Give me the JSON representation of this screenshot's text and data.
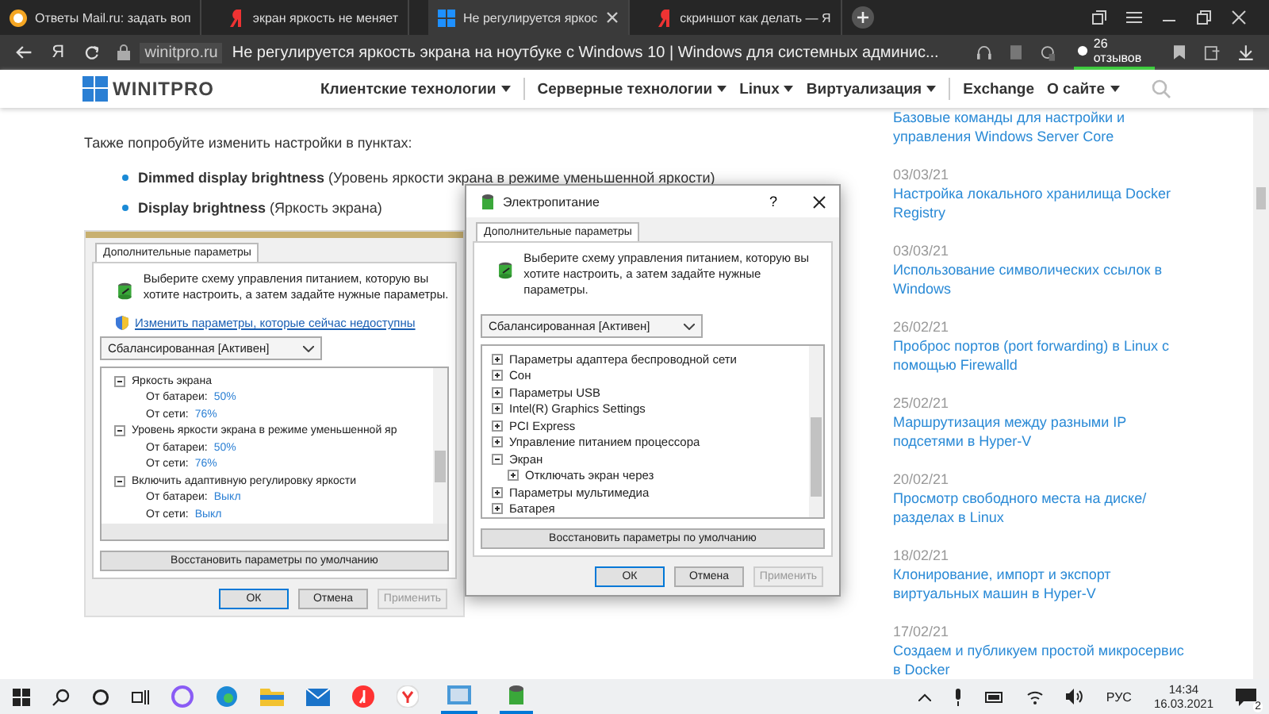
{
  "browser": {
    "tabs": [
      {
        "title": "Ответы Mail.ru: задать воп",
        "selected": false
      },
      {
        "title": "экран яркость не меняет",
        "selected": false
      },
      {
        "title": "Не регулируется яркос",
        "selected": true
      },
      {
        "title": "скриншот как делать — Я",
        "selected": false
      }
    ],
    "logo": "Я",
    "domain": "winitpro.ru",
    "page_title": "Не регулируется яркость экрана на ноутбуке с Windows 10 | Windows для системных админис...",
    "reviews": "26 отзывов"
  },
  "site": {
    "logo": "WINITPRO",
    "nav": [
      {
        "label": "Клиентские технологии",
        "dropdown": true
      },
      {
        "label": "Серверные технологии",
        "dropdown": true
      },
      {
        "label": "Linux",
        "dropdown": true
      },
      {
        "label": "Виртуализация",
        "dropdown": true
      },
      {
        "label": "Exchange",
        "dropdown": false
      },
      {
        "label": "О сайте",
        "dropdown": true
      }
    ]
  },
  "article": {
    "intro": "Также попробуйте изменить настройки в пунктах:",
    "bullets": [
      "**Dimmed display brightness** (Уровень яркости экрана в режиме уменьшенной яркости)",
      "**Display brightness** (Яркость экрана)"
    ]
  },
  "screenshot": {
    "tab": "Дополнительные параметры",
    "description": "Выберите схему управления питанием, которую вы хотите настроить, а затем задайте нужные параметры.",
    "link": "Изменить параметры, которые сейчас недоступны",
    "scheme": "Сбалансированная [Активен]",
    "tree": [
      {
        "label": "Яркость экрана",
        "expanded": true,
        "children": [
          {
            "label": "От батареи:",
            "value": "50%"
          },
          {
            "label": "От сети:",
            "value": "76%"
          }
        ]
      },
      {
        "label": "Уровень яркости экрана в режиме уменьшенной яр",
        "expanded": true,
        "children": [
          {
            "label": "От батареи:",
            "value": "50%"
          },
          {
            "label": "От сети:",
            "value": "76%"
          }
        ]
      },
      {
        "label": "Включить адаптивную регулировку яркости",
        "expanded": true,
        "children": [
          {
            "label": "От батареи:",
            "value": "Выкл"
          },
          {
            "label": "От сети:",
            "value": "Выкл"
          }
        ]
      }
    ],
    "restore": "Восстановить параметры по умолчанию",
    "buttons": [
      {
        "label": "ОК",
        "disabled": false
      },
      {
        "label": "Отмена",
        "disabled": false
      },
      {
        "label": "Применить",
        "disabled": true
      }
    ]
  },
  "dialog": {
    "title": "Электропитание",
    "help": "?",
    "tab": "Дополнительные параметры",
    "description": "Выберите схему управления питанием, которую вы хотите настроить, а затем задайте нужные параметры.",
    "scheme": "Сбалансированная [Активен]",
    "tree": [
      {
        "label": "Параметры адаптера беспроводной сети",
        "expanded": false
      },
      {
        "label": "Сон",
        "expanded": false
      },
      {
        "label": "Параметры USB",
        "expanded": false
      },
      {
        "label": "Intel(R) Graphics Settings",
        "expanded": false
      },
      {
        "label": "PCI Express",
        "expanded": false
      },
      {
        "label": "Управление питанием процессора",
        "expanded": false
      },
      {
        "label": "Экран",
        "expanded": true,
        "children": [
          {
            "label": "Отключать экран через",
            "expanded": false
          }
        ]
      },
      {
        "label": "Параметры мультимедиа",
        "expanded": false
      },
      {
        "label": "Батарея",
        "expanded": false
      }
    ],
    "restore": "Восстановить параметры по умолчанию",
    "buttons": [
      {
        "label": "ОК",
        "disabled": false
      },
      {
        "label": "Отмена",
        "disabled": false
      },
      {
        "label": "Применить",
        "disabled": true
      }
    ]
  },
  "sidebar": {
    "posts": [
      {
        "title": "Базовые команды для настройки и управления Windows Server Core"
      },
      {
        "date": "03/03/21",
        "title": "Настройка локального хранилища Docker Registry"
      },
      {
        "date": "03/03/21",
        "title": "Использование символических ссылок в Windows"
      },
      {
        "date": "26/02/21",
        "title": "Проброс портов (port forwarding) в Linux с помощью Firewalld"
      },
      {
        "date": "25/02/21",
        "title": "Маршрутизация между разными IP подсетями в Hyper-V"
      },
      {
        "date": "20/02/21",
        "title": "Просмотр свободного места на диске/разделах в Linux"
      },
      {
        "date": "18/02/21",
        "title": "Клонирование, импорт и экспорт виртуальных машин в Hyper-V"
      },
      {
        "date": "17/02/21",
        "title": "Создаем и публикуем простой микросервис в Docker"
      }
    ]
  },
  "taskbar": {
    "language": "РУС",
    "time": "14:34",
    "date": "16.03.2021",
    "notifications": "2"
  }
}
